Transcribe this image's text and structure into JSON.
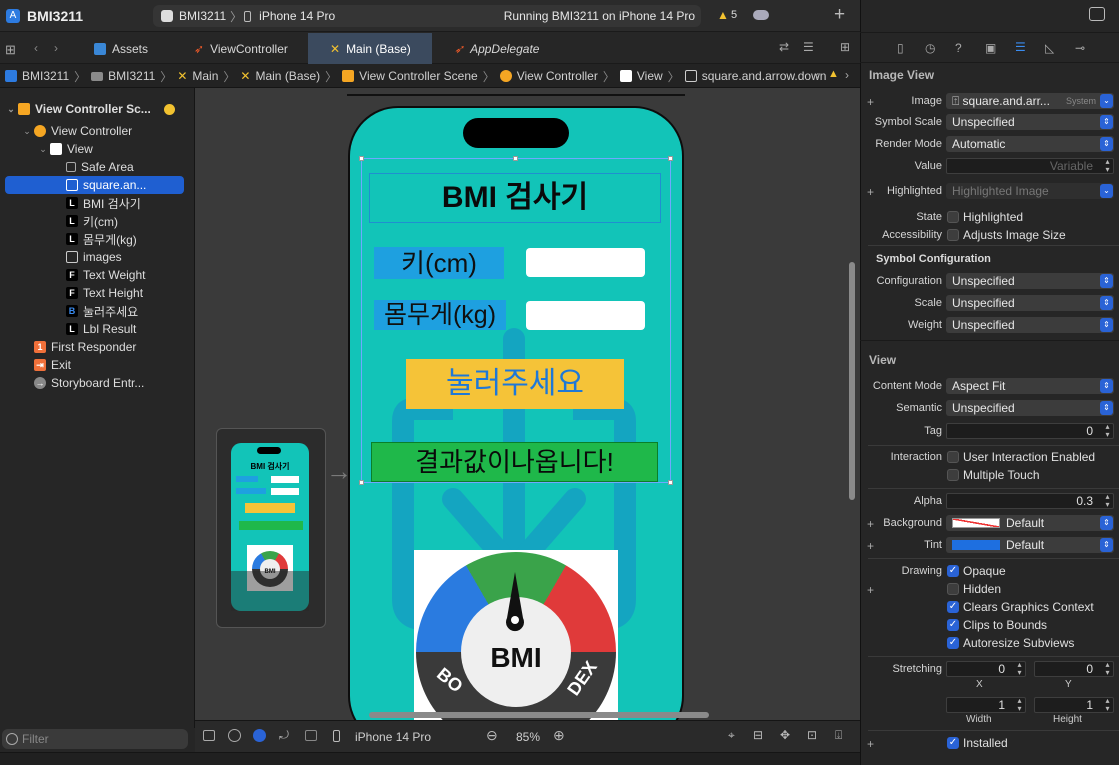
{
  "toolbar": {
    "project": "BMI3211",
    "scheme": "BMI3211",
    "device": "iPhone 14 Pro",
    "status": "Running BMI3211 on iPhone 14 Pro",
    "warnings": "5"
  },
  "tabs": [
    {
      "label": "Assets"
    },
    {
      "label": "ViewController"
    },
    {
      "label": "Main (Base)"
    },
    {
      "label": "AppDelegate"
    }
  ],
  "breadcrumb": [
    "BMI3211",
    "BMI3211",
    "Main",
    "Main (Base)",
    "View Controller Scene",
    "View Controller",
    "View",
    "square.and.arrow.down"
  ],
  "navigator": {
    "items": [
      {
        "label": "View Controller Sc...",
        "badge": "scene"
      },
      {
        "label": "View Controller",
        "badge": "vc"
      },
      {
        "label": "View",
        "badge": "view"
      },
      {
        "label": "Safe Area",
        "badge": "safe"
      },
      {
        "label": "square.an...",
        "badge": "img"
      },
      {
        "label": "BMI 검사기",
        "badge": "L"
      },
      {
        "label": "키(cm)",
        "badge": "L"
      },
      {
        "label": "몸무게(kg)",
        "badge": "L"
      },
      {
        "label": "images",
        "badge": "img"
      },
      {
        "label": "Text Weight",
        "badge": "F"
      },
      {
        "label": "Text Height",
        "badge": "F"
      },
      {
        "label": "눌러주세요",
        "badge": "B"
      },
      {
        "label": "Lbl Result",
        "badge": "L"
      },
      {
        "label": "First Responder",
        "badge": "fr"
      },
      {
        "label": "Exit",
        "badge": "exit"
      },
      {
        "label": "Storyboard Entr...",
        "badge": "entry"
      }
    ],
    "filter_placeholder": "Filter"
  },
  "canvas": {
    "app_title": "BMI 검사기",
    "height_label": "키(cm)",
    "weight_label": "몸무게(kg)",
    "button_label": "눌러주세요",
    "result_label": "결과값이나옵니다!",
    "bmi_text": "BMI",
    "ring_left": "BO",
    "ring_right": "DEX",
    "device": "iPhone 14 Pro",
    "zoom": "85%"
  },
  "inspector": {
    "section_image_view": "Image View",
    "image_label": "Image",
    "image_value": "square.and.arr...",
    "image_source": "System",
    "symbol_scale_label": "Symbol Scale",
    "symbol_scale_value": "Unspecified",
    "render_mode_label": "Render Mode",
    "render_mode_value": "Automatic",
    "value_label": "Value",
    "value_placeholder": "Variable",
    "highlighted_label": "Highlighted",
    "highlighted_placeholder": "Highlighted Image",
    "state_label": "State",
    "state_check": "Highlighted",
    "accessibility_label": "Accessibility",
    "accessibility_check": "Adjusts Image Size",
    "symbol_config_header": "Symbol Configuration",
    "configuration_label": "Configuration",
    "configuration_value": "Unspecified",
    "scale_label": "Scale",
    "scale_value": "Unspecified",
    "weight_label": "Weight",
    "weight_value": "Unspecified",
    "section_view": "View",
    "content_mode_label": "Content Mode",
    "content_mode_value": "Aspect Fit",
    "semantic_label": "Semantic",
    "semantic_value": "Unspecified",
    "tag_label": "Tag",
    "tag_value": "0",
    "interaction_label": "Interaction",
    "user_interaction": "User Interaction Enabled",
    "multiple_touch": "Multiple Touch",
    "alpha_label": "Alpha",
    "alpha_value": "0.3",
    "background_label": "Background",
    "background_value": "Default",
    "tint_label": "Tint",
    "tint_value": "Default",
    "drawing_label": "Drawing",
    "opaque": "Opaque",
    "hidden": "Hidden",
    "clears_context": "Clears Graphics Context",
    "clips_bounds": "Clips to Bounds",
    "autoresize": "Autoresize Subviews",
    "stretching_label": "Stretching",
    "stretch_x": "0",
    "stretch_y": "0",
    "x_label": "X",
    "y_label": "Y",
    "width_value": "1",
    "height_value": "1",
    "width_label": "Width",
    "height_label": "Height",
    "installed": "Installed"
  },
  "colors": {
    "accent": "#2a63d6",
    "phone_bg": "#12c4b8",
    "button_bg": "#f5c338",
    "result_bg": "#1fb84a",
    "label_bg": "#1ea0e0"
  }
}
